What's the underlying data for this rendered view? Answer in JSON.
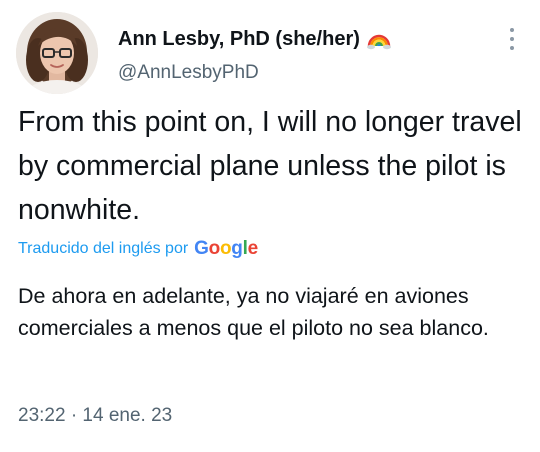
{
  "author": {
    "display_name": "Ann Lesby, PhD (she/her)",
    "handle": "@AnnLesbyPhD",
    "badge_icon": "rainbow-icon"
  },
  "tweet": {
    "text": "From this point on, I will no longer travel by commercial plane unless the pilot is nonwhite."
  },
  "translation": {
    "label": "Traducido del inglés por",
    "provider_letters": [
      "G",
      "o",
      "o",
      "g",
      "l",
      "e"
    ],
    "text": "De ahora en adelante, ya no viajaré en aviones comerciales a menos que el piloto no sea blanco."
  },
  "meta": {
    "timestamp": "23:22 · 14 ene. 23"
  },
  "colors": {
    "link": "#1d9bf0",
    "secondary_text": "#536471",
    "primary_text": "#0f1419"
  },
  "icons": {
    "more": "more-options-icon",
    "avatar": "avatar"
  }
}
